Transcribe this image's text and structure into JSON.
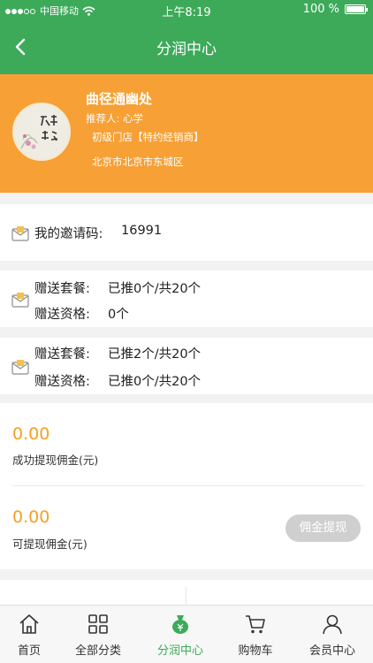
{
  "status_bar": {
    "carrier": "中国移动",
    "time": "上午8:19",
    "battery": "100 %"
  },
  "header": {
    "title": "分润中心"
  },
  "profile": {
    "name": "曲径通幽处",
    "referrer": "推荐人: 心学",
    "level": "初级门店【特约经销商】",
    "address": "北京市北京市东城区",
    "avatar_text": "凡尘清心"
  },
  "invite": {
    "label": "我的邀请码:",
    "code": "16991"
  },
  "gift_group_1": {
    "package_label": "赠送套餐:",
    "package_value": "已推0个/共20个",
    "qualify_label": "赠送资格:",
    "qualify_value": "0个"
  },
  "gift_group_2": {
    "package_label": "赠送套餐:",
    "package_value": "已推2个/共20个",
    "qualify_label": "赠送资格:",
    "qualify_value": "已推0个/共20个"
  },
  "commission": {
    "withdrawn_amount": "0.00",
    "withdrawn_label": "成功提现佣金(元)",
    "available_amount": "0.00",
    "available_label": "可提现佣金(元)",
    "withdraw_button": "佣金提现"
  },
  "tabbar": {
    "items": [
      {
        "label": "首页",
        "icon": "home-icon"
      },
      {
        "label": "全部分类",
        "icon": "grid-icon"
      },
      {
        "label": "分润中心",
        "icon": "money-bag-icon"
      },
      {
        "label": "购物车",
        "icon": "cart-icon"
      },
      {
        "label": "会员中心",
        "icon": "user-icon"
      }
    ],
    "active_index": 2
  },
  "colors": {
    "primary": "#3daa5a",
    "profile_bg": "#f6a035",
    "amount": "#f5a023"
  }
}
